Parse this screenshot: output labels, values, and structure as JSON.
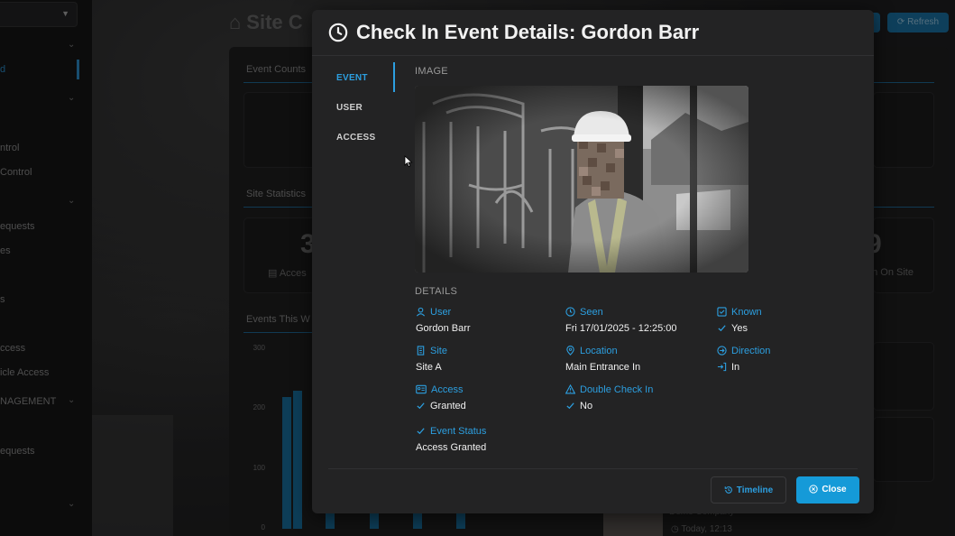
{
  "background": {
    "app_title": "Site C",
    "sidebar_items": [
      "d",
      "ntrol",
      "Control",
      "equests",
      "es",
      "s",
      "ccess",
      "icle Access",
      "NAGEMENT",
      "equests"
    ],
    "top_buttons": {
      "refresh": "Refresh"
    },
    "panels": {
      "event_counts": "Event Counts",
      "site_statistics": "Site Statistics",
      "events_this_week": "Events This W"
    },
    "stats": {
      "left_number": "3",
      "left_sub": "Acces",
      "right_number": "9",
      "right_sub": "en On Site"
    },
    "chart_axis": [
      "300",
      "200",
      "100",
      "0"
    ],
    "recent": {
      "company": "Demo Company",
      "time": "Today, 12:13"
    }
  },
  "modal": {
    "title": "Check In Event Details: Gordon Barr",
    "tabs": [
      {
        "label": "EVENT",
        "active": true
      },
      {
        "label": "USER",
        "active": false
      },
      {
        "label": "ACCESS",
        "active": false
      }
    ],
    "image_heading": "IMAGE",
    "details_heading": "DETAILS",
    "fields": {
      "user": {
        "label": "User",
        "value": "Gordon Barr"
      },
      "seen": {
        "label": "Seen",
        "value": "Fri 17/01/2025 - 12:25:00"
      },
      "known": {
        "label": "Known",
        "value": "Yes"
      },
      "site": {
        "label": "Site",
        "value": "Site A"
      },
      "location": {
        "label": "Location",
        "value": "Main Entrance In"
      },
      "direction": {
        "label": "Direction",
        "value": "In"
      },
      "access": {
        "label": "Access",
        "value": "Granted"
      },
      "double_check_in": {
        "label": "Double Check In",
        "value": "No"
      },
      "event_status": {
        "label": "Event Status",
        "value": "Access Granted"
      }
    },
    "buttons": {
      "timeline": "Timeline",
      "close": "Close"
    }
  },
  "colors": {
    "accent": "#2c9fe0",
    "close_button": "#159ad8",
    "modal_bg": "#232324"
  }
}
